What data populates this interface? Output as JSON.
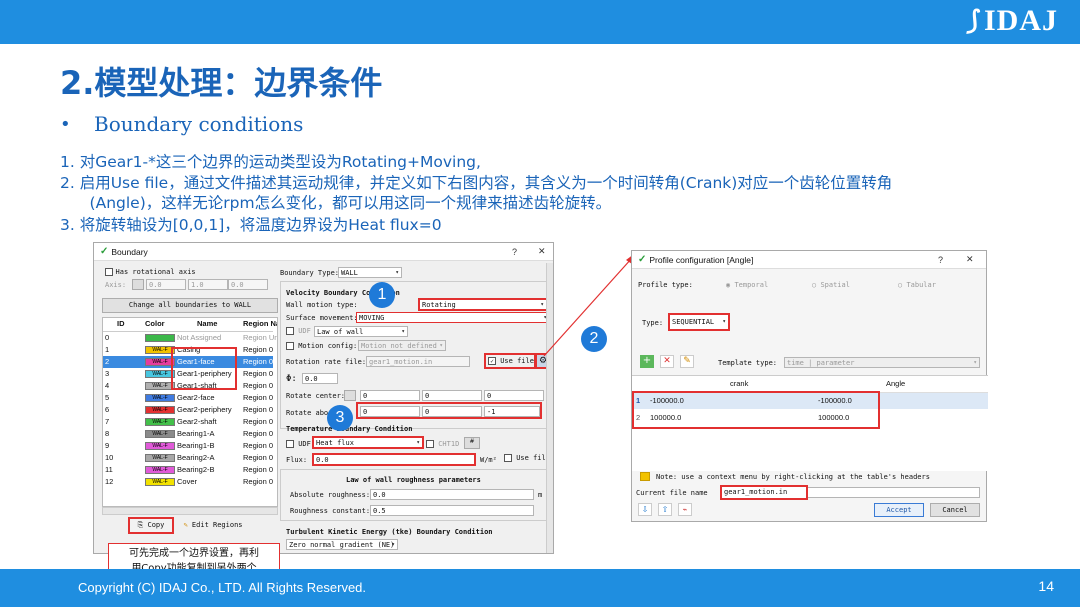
{
  "header": {
    "logo_text": "IDAJ",
    "title": "2.模型处理：边界条件",
    "subtitle_bullet": "•",
    "subtitle": "Boundary conditions",
    "steps": [
      "1.  对Gear1-*这三个边界的运动类型设为Rotating+Moving,",
      "2.  启用Use file，通过文件描述其运动规律，并定义如下右图内容，其含义为一个时间转角(Crank)对应一个齿轮位置转角",
      "      (Angle)，这样无论rpm怎么变化，都可以用这同一个规律来描述齿轮旋转。",
      "3.  将旋转轴设为[0,0,1]，将温度边界设为Heat flux=0"
    ]
  },
  "boundary_dialog": {
    "title": "Boundary",
    "help": "?",
    "close": "✕",
    "has_rotational_axis": "Has rotational axis",
    "axis_label": "Axis:",
    "axis_values": [
      "0.0",
      "1.0",
      "0.0"
    ],
    "change_all": "Change all boundaries to WALL",
    "columns": [
      "ID",
      "Color",
      "Name",
      "Region Na"
    ],
    "rows": [
      {
        "id": "0",
        "chip": "",
        "color": "#3cb84a",
        "name": "Not Assigned",
        "region": "Region Un",
        "grey": true
      },
      {
        "id": "1",
        "chip": "WAL-F",
        "color": "#f2c200",
        "name": "Casing",
        "region": "Region 0"
      },
      {
        "id": "2",
        "chip": "WAL-F",
        "color": "#e53b9e",
        "name": "Gear1-face",
        "region": "Region 0",
        "selected": true
      },
      {
        "id": "3",
        "chip": "WAL-F",
        "color": "#47c6e0",
        "name": "Gear1-periphery",
        "region": "Region 0"
      },
      {
        "id": "4",
        "chip": "WAL-F",
        "color": "#b0b0b0",
        "name": "Gear1-shaft",
        "region": "Region 0"
      },
      {
        "id": "5",
        "chip": "WAL-F",
        "color": "#3f7be0",
        "name": "Gear2-face",
        "region": "Region 0"
      },
      {
        "id": "6",
        "chip": "WAL-F",
        "color": "#e33131",
        "name": "Gear2-periphery",
        "region": "Region 0"
      },
      {
        "id": "7",
        "chip": "WAL-F",
        "color": "#43c04a",
        "name": "Gear2-shaft",
        "region": "Region 0"
      },
      {
        "id": "8",
        "chip": "WAL-F",
        "color": "#8a8a8a",
        "name": "Bearing1-A",
        "region": "Region 0"
      },
      {
        "id": "9",
        "chip": "WAL-F",
        "color": "#e05ad8",
        "name": "Bearing1-B",
        "region": "Region 0"
      },
      {
        "id": "10",
        "chip": "WAL-F",
        "color": "#a8a8a8",
        "name": "Bearing2-A",
        "region": "Region 0"
      },
      {
        "id": "11",
        "chip": "WAL-F",
        "color": "#e05ad8",
        "name": "Bearing2-B",
        "region": "Region 0"
      },
      {
        "id": "12",
        "chip": "WAL-F",
        "color": "#f2e200",
        "name": "Cover",
        "region": "Region 0"
      }
    ],
    "copy_button": "Copy",
    "edit_regions_button": "Edit Regions",
    "boundary_type_label": "Boundary Type:",
    "boundary_type_value": "WALL",
    "velocity_title": "Velocity Boundary Condition",
    "wall_motion_label": "Wall motion type:",
    "wall_motion_value": "Rotating",
    "surface_movement_label": "Surface movement:",
    "surface_movement_value": "MOVING",
    "udf_label": "UDF",
    "law_of_wall_value": "Law of wall",
    "motion_config_label": "Motion config:",
    "motion_config_value": "Motion not defined",
    "rotation_file_label": "Rotation rate file:",
    "rotation_file_value": "gear1_motion.in",
    "use_file_label": "Use file",
    "phi_label": "Φ:",
    "phi_value": "0.0",
    "rotate_center_label": "Rotate center:",
    "rotate_center_values": [
      "0",
      "0",
      "0"
    ],
    "rotate_about_label": "Rotate abo",
    "rotate_about_values": [
      "0",
      "0",
      "-1"
    ],
    "temp_title": "Temperature Boundary Condition",
    "temp_udf_label": "UDF",
    "temp_type_value": "Heat flux",
    "cht1d_label": "CHT1D",
    "flux_label": "Flux:",
    "flux_value": "0.0",
    "flux_unit": "W/m²",
    "flux_use_file": "Use file",
    "law_params_title": "Law of wall roughness parameters",
    "abs_roughness_label": "Absolute roughness:",
    "abs_roughness_value": "0.0",
    "abs_roughness_unit": "m",
    "roughness_const_label": "Roughness constant:",
    "roughness_const_value": "0.5",
    "tke_title": "Turbulent Kinetic Energy (tke) Boundary Condition",
    "tke_value": "Zero normal gradient (NE)"
  },
  "profile_dialog": {
    "title": "Profile configuration [Angle]",
    "help": "?",
    "close": "✕",
    "profile_type_label": "Profile type:",
    "profile_types": [
      "Temporal",
      "Spatial",
      "Tabular"
    ],
    "type_label": "Type:",
    "type_value": "SEQUENTIAL",
    "template_type_label": "Template type:",
    "template_type_value": "time | parameter",
    "columns": [
      "crank",
      "Angle"
    ],
    "rows": [
      {
        "n": "1",
        "crank": "-100000.0",
        "angle": "-100000.0"
      },
      {
        "n": "2",
        "crank": "100000.0",
        "angle": "100000.0"
      }
    ],
    "note": "Note: use a context menu by right-clicking at the table's headers",
    "current_file_label": "Current file name",
    "current_file_value": "gear1_motion.in",
    "accept": "Accept",
    "cancel": "Cancel"
  },
  "callouts": {
    "one": "1",
    "two": "2",
    "three": "3",
    "note_line1": "可先完成一个边界设置，再利",
    "note_line2": "用Copy功能复制到另外两个"
  },
  "footer": {
    "copyright": "Copyright (C)  IDAJ Co., LTD. All Rights Reserved.",
    "page": "14"
  },
  "colors": {
    "accent": "#1f8ee0",
    "title": "#1a64b8",
    "highlight": "#e23030"
  }
}
